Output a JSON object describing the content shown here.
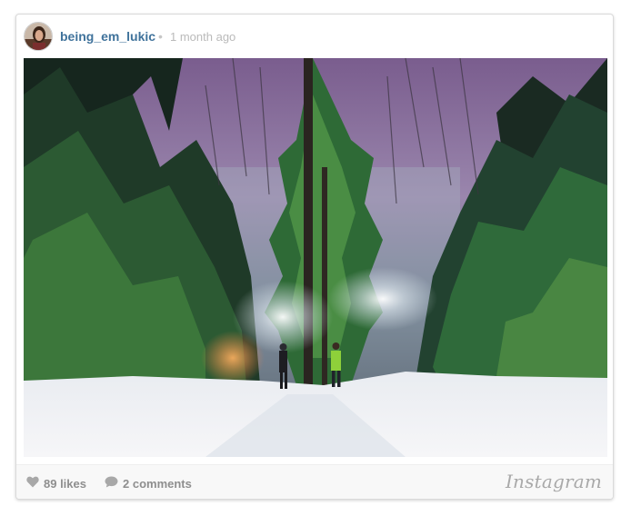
{
  "post": {
    "username": "being_em_lukic",
    "separator": "•",
    "time_ago": "1 month ago"
  },
  "photo": {
    "scene": "snowy-forest-night"
  },
  "footer": {
    "likes": "89 likes",
    "comments": "2 comments",
    "brand": "Instagram"
  },
  "colors": {
    "username": "#3f729b",
    "meta": "#8e8e8e",
    "footer_bg": "#f8f8f8"
  },
  "icons": [
    "heart-icon",
    "comment-icon"
  ]
}
